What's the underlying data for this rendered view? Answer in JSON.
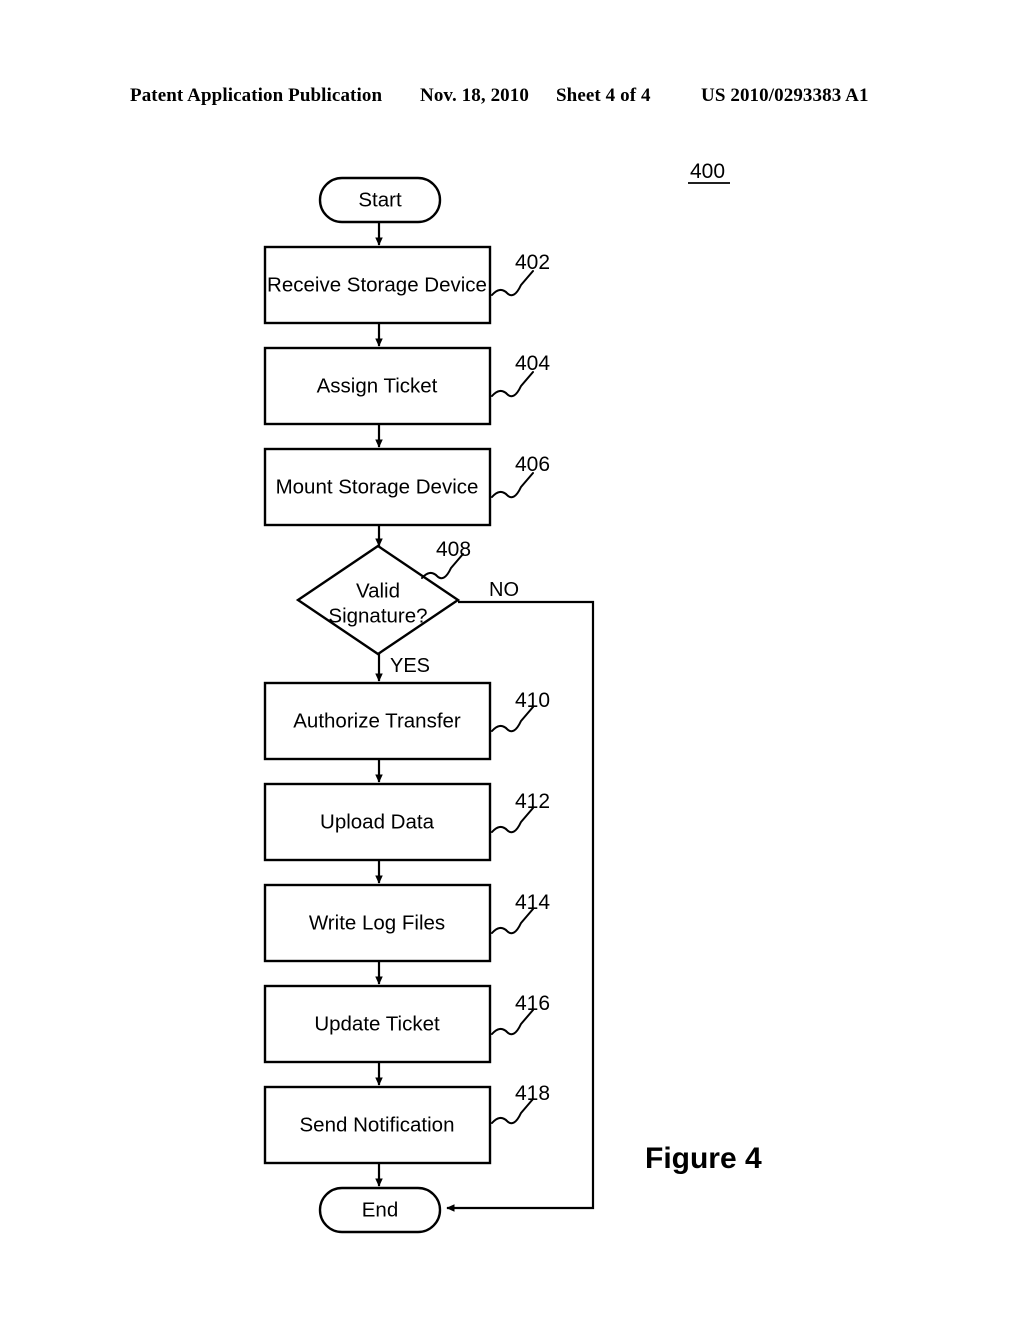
{
  "header": {
    "publication": "Patent Application Publication",
    "date": "Nov. 18, 2010",
    "sheet": "Sheet 4 of 4",
    "pub_number": "US 2010/0293383 A1"
  },
  "figure": {
    "caption": "Figure 4",
    "identifier": "400"
  },
  "flowchart": {
    "start_label": "Start",
    "end_label": "End",
    "branch_yes": "YES",
    "branch_no": "NO",
    "decision": {
      "line1": "Valid",
      "line2": "Signature?",
      "ref": "408"
    },
    "steps": [
      {
        "label": "Receive Storage Device",
        "ref": "402"
      },
      {
        "label": "Assign Ticket",
        "ref": "404"
      },
      {
        "label": "Mount Storage Device",
        "ref": "406"
      },
      {
        "label": "Authorize Transfer",
        "ref": "410"
      },
      {
        "label": "Upload Data",
        "ref": "412"
      },
      {
        "label": "Write Log Files",
        "ref": "414"
      },
      {
        "label": "Update Ticket",
        "ref": "416"
      },
      {
        "label": "Send Notification",
        "ref": "418"
      }
    ]
  },
  "colors": {
    "ink": "#000000",
    "paper": "#ffffff"
  }
}
